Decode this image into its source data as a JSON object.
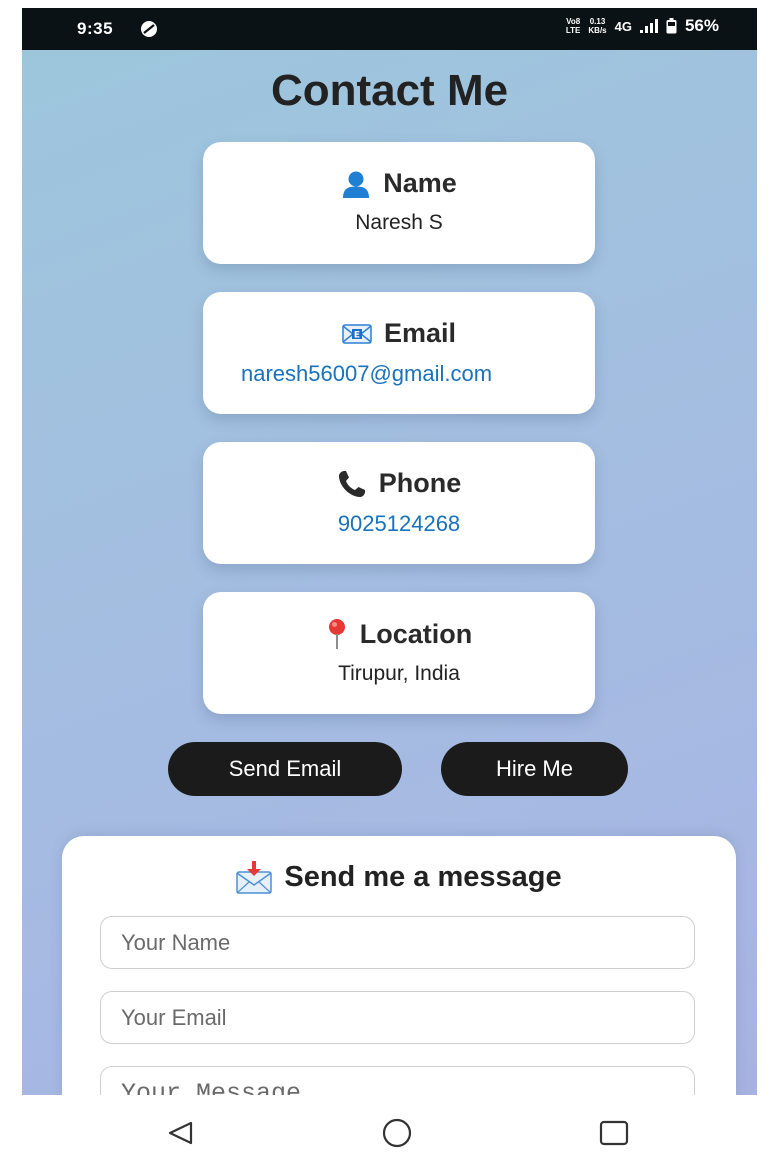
{
  "status_bar": {
    "time": "9:35",
    "volte_top": "Vo8",
    "volte_bottom": "LTE",
    "speed_top": "0.13",
    "speed_bottom": "KB/s",
    "network": "4G",
    "battery": "56%"
  },
  "page": {
    "title": "Contact Me"
  },
  "cards": {
    "name": {
      "label": "Name",
      "value": "Naresh S",
      "icon": "person-icon"
    },
    "email": {
      "label": "Email",
      "value": "naresh56007@gmail.com",
      "icon": "email-icon"
    },
    "phone": {
      "label": "Phone",
      "value": "9025124268",
      "icon": "phone-icon"
    },
    "location": {
      "label": "Location",
      "value": "Tirupur, India",
      "icon": "map-pin-icon"
    }
  },
  "actions": {
    "send_email": "Send Email",
    "hire_me": "Hire Me"
  },
  "form": {
    "heading": "Send me a message",
    "name_placeholder": "Your Name",
    "email_placeholder": "Your Email",
    "message_placeholder": "Your Message"
  },
  "colors": {
    "link": "#1a72bb",
    "button_bg": "#1b1b1b",
    "status_bar_bg": "#0b1215"
  }
}
